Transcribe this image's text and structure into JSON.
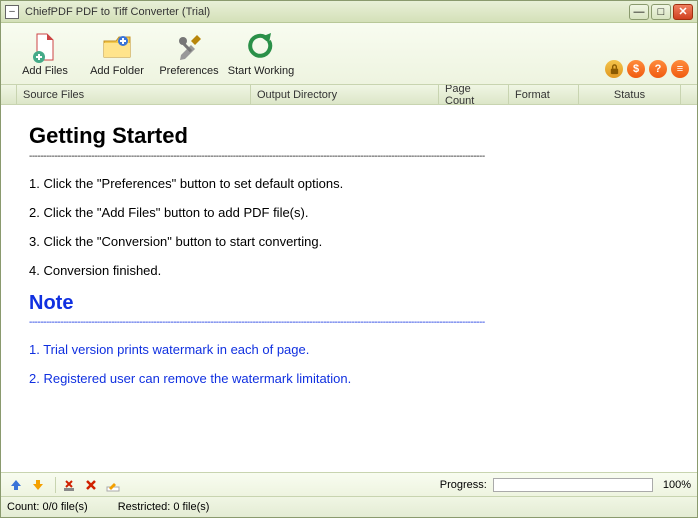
{
  "window": {
    "title": "ChiefPDF PDF to Tiff Converter (Trial)"
  },
  "toolbar": {
    "add_files": "Add Files",
    "add_folder": "Add Folder",
    "preferences": "Preferences",
    "start_working": "Start Working"
  },
  "right_icons": {
    "lock": "lock-icon",
    "buy": "$",
    "help": "?",
    "doc": "≡"
  },
  "columns": {
    "source_files": "Source Files",
    "output_directory": "Output Directory",
    "page_count": "Page Count",
    "format": "Format",
    "status": "Status"
  },
  "content": {
    "heading": "Getting Started",
    "dash_line": "-----------------------------------------------------------------------------------------------------------------------------------------------------------------",
    "steps": [
      "1. Click the \"Preferences\" button to set default options.",
      "2. Click the \"Add Files\" button to add PDF file(s).",
      "3. Click the \"Conversion\" button to start converting.",
      "4. Conversion finished."
    ],
    "note_heading": "Note",
    "notes": [
      "1. Trial version prints watermark in each of page.",
      "2. Registered user can remove the watermark limitation."
    ]
  },
  "bottombar": {
    "progress_label": "Progress:",
    "progress_pct": "100%"
  },
  "statusbar": {
    "count_label": "Count:",
    "count_value": "0/0 file(s)",
    "restricted_label": "Restricted:",
    "restricted_value": "0 file(s)"
  }
}
